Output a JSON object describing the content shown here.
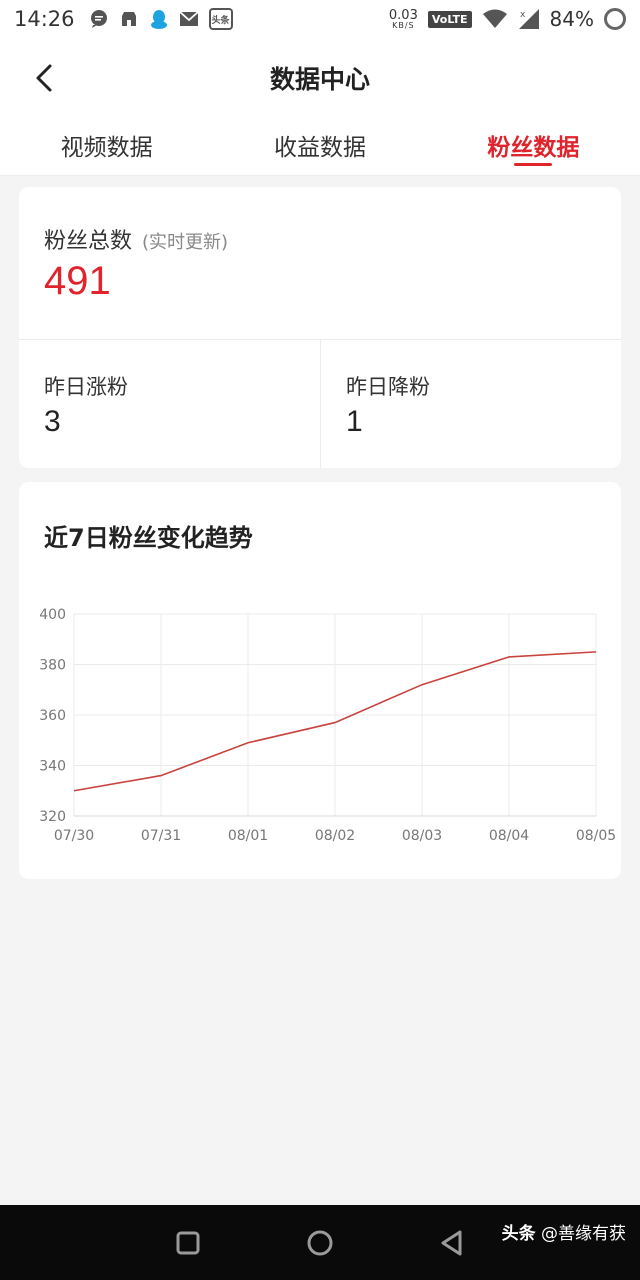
{
  "status_bar": {
    "time": "14:26",
    "net_speed_value": "0.03",
    "net_speed_unit": "KB/S",
    "volte_label": "VoLTE",
    "battery": "84%",
    "app_badge_text": "头条"
  },
  "header": {
    "title": "数据中心"
  },
  "tabs": [
    {
      "label": "视频数据",
      "active": false
    },
    {
      "label": "收益数据",
      "active": false
    },
    {
      "label": "粉丝数据",
      "active": true
    }
  ],
  "summary": {
    "total_label": "粉丝总数",
    "total_note": "(实时更新)",
    "total_value": "491",
    "yesterday_gain_label": "昨日涨粉",
    "yesterday_gain_value": "3",
    "yesterday_loss_label": "昨日降粉",
    "yesterday_loss_value": "1"
  },
  "trend": {
    "title": "近7日粉丝变化趋势"
  },
  "chart_data": {
    "type": "line",
    "title": "近7日粉丝变化趋势",
    "categories": [
      "07/30",
      "07/31",
      "08/01",
      "08/02",
      "08/03",
      "08/04",
      "08/05"
    ],
    "series": [
      {
        "values": [
          330,
          336,
          349,
          357,
          372,
          383,
          385
        ]
      }
    ],
    "ylim": [
      320,
      400
    ],
    "yticks": [
      400,
      380,
      360,
      340,
      320
    ],
    "grid": true,
    "line_color": "#c9433e"
  },
  "watermark": {
    "brand": "头条",
    "handle": "@善缘有获"
  },
  "colors": {
    "accent": "#e0242c",
    "background": "#f4f4f4",
    "navbar": "#0a0a0a"
  }
}
